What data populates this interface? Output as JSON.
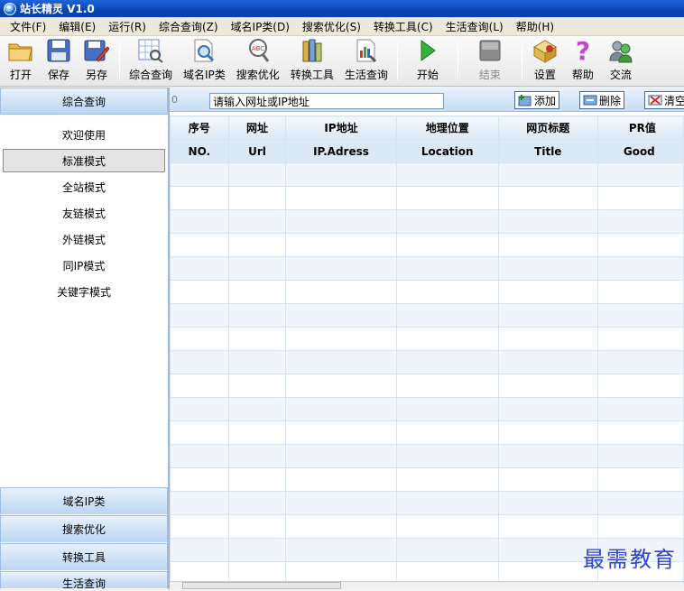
{
  "window": {
    "title": "站长精灵 V1.0"
  },
  "menu": [
    "文件(F)",
    "编辑(E)",
    "运行(R)",
    "综合查询(Z)",
    "域名IP类(D)",
    "搜索优化(S)",
    "转换工具(C)",
    "生活查询(L)",
    "帮助(H)"
  ],
  "toolbar": {
    "open": "打开",
    "save": "保存",
    "saveas": "另存",
    "query": "综合查询",
    "domainip": "域名IP类",
    "seo": "搜索优化",
    "convert": "转换工具",
    "life": "生活查询",
    "start": "开始",
    "stop": "结束",
    "settings": "设置",
    "help": "帮助",
    "exchange": "交流"
  },
  "left": {
    "header": "综合查询",
    "modes": [
      "欢迎使用",
      "标准模式",
      "全站模式",
      "友链模式",
      "外链模式",
      "同IP模式",
      "关键字模式"
    ],
    "selected_mode": "标准模式",
    "bottom": [
      "域名IP类",
      "搜索优化",
      "转换工具",
      "生活查询"
    ]
  },
  "url_bar": {
    "count": "0",
    "input_value": "请输入网址或IP地址",
    "add": "添加",
    "delete": "删除",
    "clear": "清空"
  },
  "table": {
    "headers_cn": [
      "序号",
      "网址",
      "IP地址",
      "地理位置",
      "网页标题",
      "PR值"
    ],
    "headers_en": [
      "NO.",
      "Url",
      "IP.Adress",
      "Location",
      "Title",
      "Good"
    ]
  },
  "watermark": "最需教育"
}
